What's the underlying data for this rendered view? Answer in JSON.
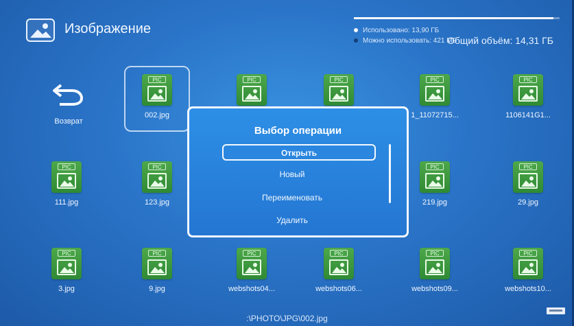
{
  "header": {
    "title": "Изображение",
    "used_label": "Использовано: 13,90 ГБ",
    "available_label": "Можно использовать: 421 МБ",
    "total_label": "Общий объём: 14,31 ГБ",
    "storage_used_fraction": 0.97
  },
  "back": {
    "label": "Возврат"
  },
  "files": [
    {
      "label": "002.jpg",
      "tag": "PIC"
    },
    {
      "label": "",
      "tag": "PIC"
    },
    {
      "label": "",
      "tag": "PIC"
    },
    {
      "label": "1_11072715...",
      "tag": "PIC"
    },
    {
      "label": "1106141G1...",
      "tag": "PIC"
    },
    {
      "label": "111.jpg",
      "tag": "PIC"
    },
    {
      "label": "123.jpg",
      "tag": "PIC"
    },
    {
      "label": "219.jpg",
      "tag": "PIC"
    },
    {
      "label": "29.jpg",
      "tag": "PIC"
    },
    {
      "label": "3.jpg",
      "tag": "PIC"
    },
    {
      "label": "9.jpg",
      "tag": "PIC"
    },
    {
      "label": "webshots04...",
      "tag": "PIC"
    },
    {
      "label": "webshots06...",
      "tag": "PIC"
    },
    {
      "label": "webshots09...",
      "tag": "PIC"
    },
    {
      "label": "webshots10...",
      "tag": "PIC"
    }
  ],
  "dialog": {
    "title": "Выбор операции",
    "items": [
      "Открыть",
      "Новый",
      "Переименовать",
      "Удалить"
    ]
  },
  "path": ":\\PHOTO\\JPG\\002.jpg",
  "colors": {
    "tile_green": "#3f9a41",
    "accent_blue": "#2a74c8"
  }
}
